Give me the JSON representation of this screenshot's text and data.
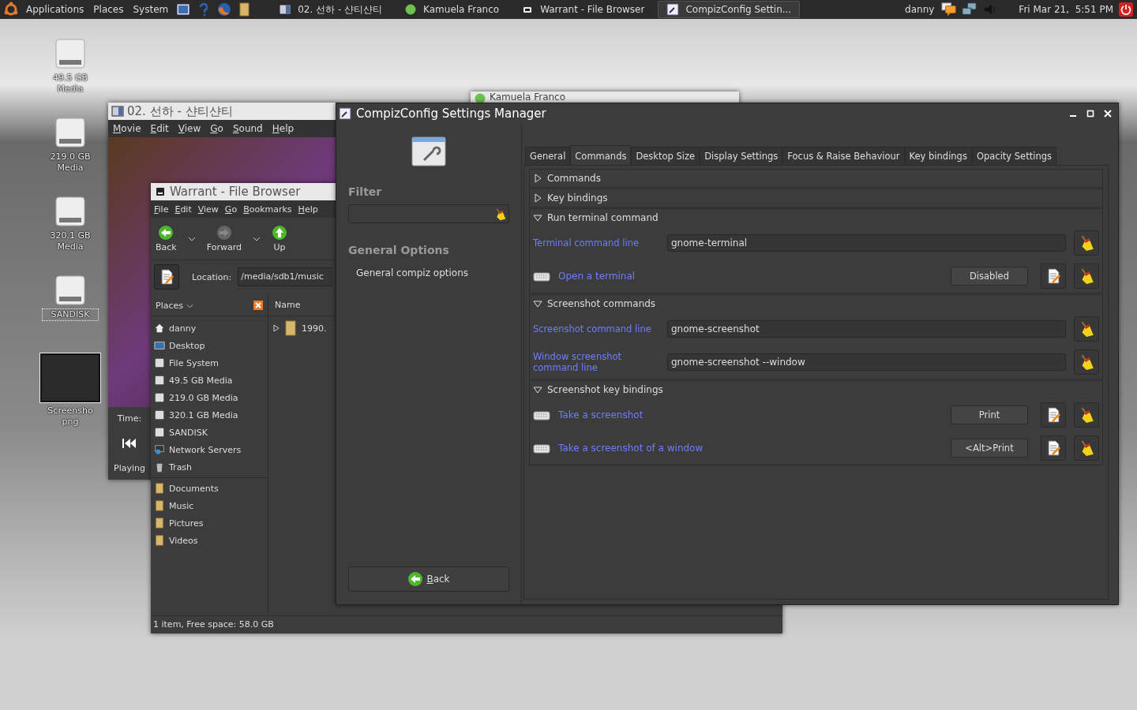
{
  "top_panel": {
    "menus": [
      "Applications",
      "Places",
      "System"
    ],
    "launchers": [
      {
        "kind": "picture"
      },
      {
        "kind": "help"
      },
      {
        "kind": "browser"
      },
      {
        "kind": "folder"
      }
    ],
    "tasks": [
      {
        "label": "02. 선하 - 샨티샨티",
        "kind": "player",
        "selected": false
      },
      {
        "label": "Kamuela Franco",
        "kind": "chat",
        "selected": false
      },
      {
        "label": "Warrant - File Browser",
        "kind": "files",
        "selected": false
      },
      {
        "label": "CompizConfig Settin...",
        "kind": "settings",
        "selected": true
      }
    ],
    "user": "danny",
    "clock": "Fri Mar 21,  5:51 PM"
  },
  "desktop_icons": [
    {
      "label": "49.5 GB Media",
      "kind": "drive",
      "selected": false
    },
    {
      "label": "219.0 GB Media",
      "kind": "drive",
      "selected": false
    },
    {
      "label": "320.1 GB Media",
      "kind": "drive",
      "selected": false
    },
    {
      "label": "SANDISK",
      "kind": "drive",
      "selected": true
    },
    {
      "label": "Screensho png",
      "kind": "image",
      "selected": false
    }
  ],
  "movie_player": {
    "title": "02. 선하 - 샨티샨티",
    "menus": [
      "Movie",
      "Edit",
      "View",
      "Go",
      "Sound",
      "Help"
    ],
    "time_label": "Time:",
    "status": "Playing"
  },
  "chat_window": {
    "title": "Kamuela Franco"
  },
  "file_browser": {
    "title": "Warrant - File Browser",
    "menus": [
      "File",
      "Edit",
      "View",
      "Go",
      "Bookmarks",
      "Help"
    ],
    "toolbar": [
      {
        "label": "Back",
        "kind": "back",
        "disabled": false
      },
      {
        "label": "Forward",
        "kind": "forward",
        "disabled": true
      },
      {
        "label": "Up",
        "kind": "up",
        "disabled": false
      }
    ],
    "location_label": "Location:",
    "location": "/media/sdb1/music",
    "places_header": "Places",
    "places": [
      {
        "label": "danny",
        "kind": "home"
      },
      {
        "label": "Desktop",
        "kind": "desktop"
      },
      {
        "label": "File System",
        "kind": "drive"
      },
      {
        "label": "49.5 GB Media",
        "kind": "drive"
      },
      {
        "label": "219.0 GB Media",
        "kind": "drive"
      },
      {
        "label": "320.1 GB Media",
        "kind": "drive"
      },
      {
        "label": "SANDISK",
        "kind": "drive"
      },
      {
        "label": "Network Servers",
        "kind": "network"
      },
      {
        "label": "Trash",
        "kind": "trash"
      }
    ],
    "bookmarks": [
      "Documents",
      "Music",
      "Pictures",
      "Videos"
    ],
    "column": "Name",
    "rows": [
      {
        "name": "1990."
      }
    ],
    "status": "1 item, Free space: 58.0 GB"
  },
  "compiz": {
    "title": "CompizConfig Settings Manager",
    "filter_label": "Filter",
    "category": "General Options",
    "items": [
      "General compiz options"
    ],
    "back_button": "Back",
    "tabs": [
      {
        "label": "General",
        "selected": false
      },
      {
        "label": "Commands",
        "selected": true
      },
      {
        "label": "Desktop Size",
        "selected": false
      },
      {
        "label": "Display Settings",
        "selected": false
      },
      {
        "label": "Focus & Raise Behaviour",
        "selected": false
      },
      {
        "label": "Key bindings",
        "selected": false
      },
      {
        "label": "Opacity Settings",
        "selected": false
      }
    ],
    "sections": [
      {
        "title": "Commands",
        "expanded": false
      },
      {
        "title": "Key bindings",
        "expanded": false
      },
      {
        "title": "Run terminal command",
        "expanded": true,
        "rows": [
          {
            "kind": "text",
            "label": "Terminal command line",
            "value": "gnome-terminal"
          },
          {
            "kind": "key",
            "label": "Open a terminal",
            "binding": "Disabled"
          }
        ]
      },
      {
        "title": "Screenshot commands",
        "expanded": true,
        "rows": [
          {
            "kind": "text",
            "label": "Screenshot command line",
            "value": "gnome-screenshot"
          },
          {
            "kind": "text",
            "label": "Window screenshot command line",
            "value": "gnome-screenshot --window"
          }
        ]
      },
      {
        "title": "Screenshot key bindings",
        "expanded": true,
        "rows": [
          {
            "kind": "key",
            "label": "Take a screenshot",
            "binding": "Print"
          },
          {
            "kind": "key",
            "label": "Take a screenshot of a window",
            "binding": "<Alt>Print"
          }
        ]
      }
    ]
  }
}
